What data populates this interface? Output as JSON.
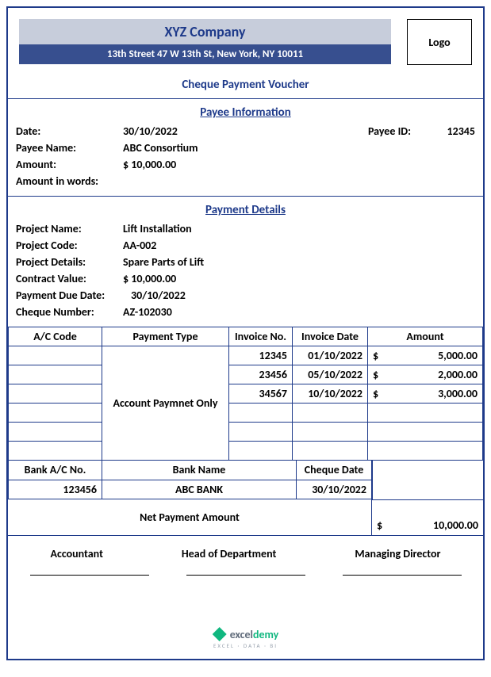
{
  "header": {
    "company": "XYZ Company",
    "address": "13th Street 47 W 13th St, New York, NY 10011",
    "logo_label": "Logo"
  },
  "title": "Cheque Payment Voucher",
  "payee_section": {
    "title": "Payee Information",
    "date_label": "Date:",
    "date_value": "30/10/2022",
    "payee_id_label": "Payee ID:",
    "payee_id_value": "12345",
    "payee_name_label": "Payee Name:",
    "payee_name_value": "ABC Consortium",
    "amount_label": "Amount:",
    "amount_value": "$ 10,000.00",
    "amount_words_label": "Amount in words:"
  },
  "payment_section": {
    "title": "Payment Details",
    "project_name_label": "Project Name:",
    "project_name_value": "Lift Installation",
    "project_code_label": "Project Code:",
    "project_code_value": "AA-002",
    "project_details_label": "Project Details:",
    "project_details_value": "Spare Parts of Lift",
    "contract_value_label": "Contract Value:",
    "contract_value_value": "$ 10,000.00",
    "due_date_label": "Payment Due Date:",
    "due_date_value": "30/10/2022",
    "cheque_number_label": "Cheque Number:",
    "cheque_number_value": "AZ-102030"
  },
  "invoice_table": {
    "headers": {
      "ac_code": "A/C Code",
      "payment_type": "Payment Type",
      "invoice_no": "Invoice No.",
      "invoice_date": "Invoice Date",
      "amount": "Amount"
    },
    "payment_type_value": "Account Paymnet Only",
    "currency_symbol": "$",
    "rows": [
      {
        "invoice_no": "12345",
        "invoice_date": "01/10/2022",
        "amount": "5,000.00"
      },
      {
        "invoice_no": "23456",
        "invoice_date": "05/10/2022",
        "amount": "2,000.00"
      },
      {
        "invoice_no": "34567",
        "invoice_date": "10/10/2022",
        "amount": "3,000.00"
      }
    ]
  },
  "bank_table": {
    "headers": {
      "bank_ac": "Bank A/C No.",
      "bank_name": "Bank Name",
      "cheque_date": "Cheque Date"
    },
    "values": {
      "bank_ac": "123456",
      "bank_name": "ABC BANK",
      "cheque_date": "30/10/2022"
    }
  },
  "net": {
    "label": "Net Payment Amount",
    "symbol": "$",
    "value": "10,000.00"
  },
  "signatures": {
    "accountant": "Accountant",
    "head": "Head of Department",
    "director": "Managing Director"
  },
  "watermark": {
    "brand1": "excel",
    "brand2": "demy",
    "sub": "EXCEL · DATA · BI"
  }
}
